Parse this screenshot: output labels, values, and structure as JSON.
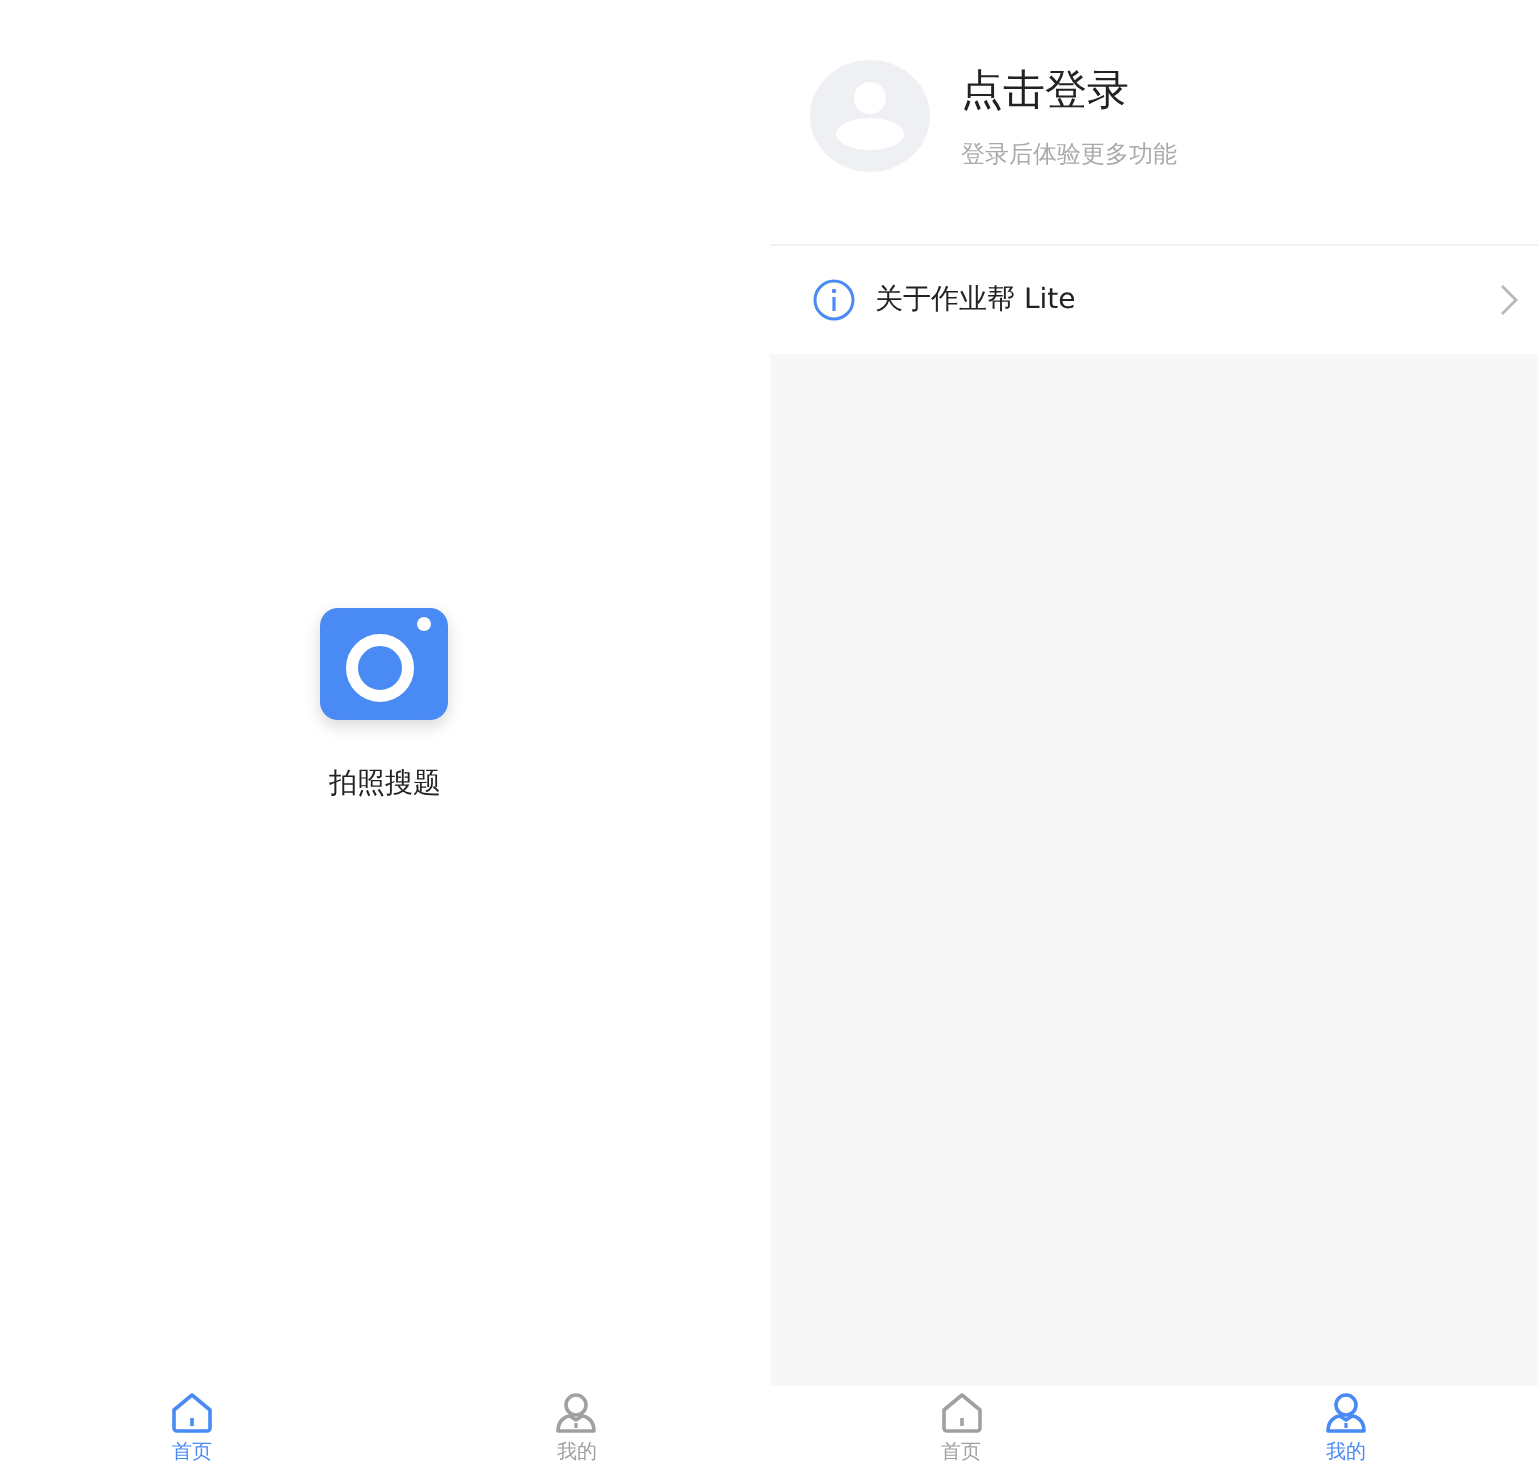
{
  "screens": [
    {
      "kind": "home",
      "action": {
        "label": "拍照搜题"
      },
      "tabs": [
        {
          "label": "首页",
          "kind": "home",
          "selected": true
        },
        {
          "label": "我的",
          "kind": "profile",
          "selected": false
        }
      ]
    },
    {
      "kind": "profile",
      "login": {
        "title": "点击登录",
        "subtitle": "登录后体验更多功能"
      },
      "menu": [
        {
          "label": "关于作业帮 Lite"
        }
      ],
      "tabs": [
        {
          "label": "首页",
          "kind": "home",
          "selected": false
        },
        {
          "label": "我的",
          "kind": "profile",
          "selected": true
        }
      ]
    }
  ]
}
